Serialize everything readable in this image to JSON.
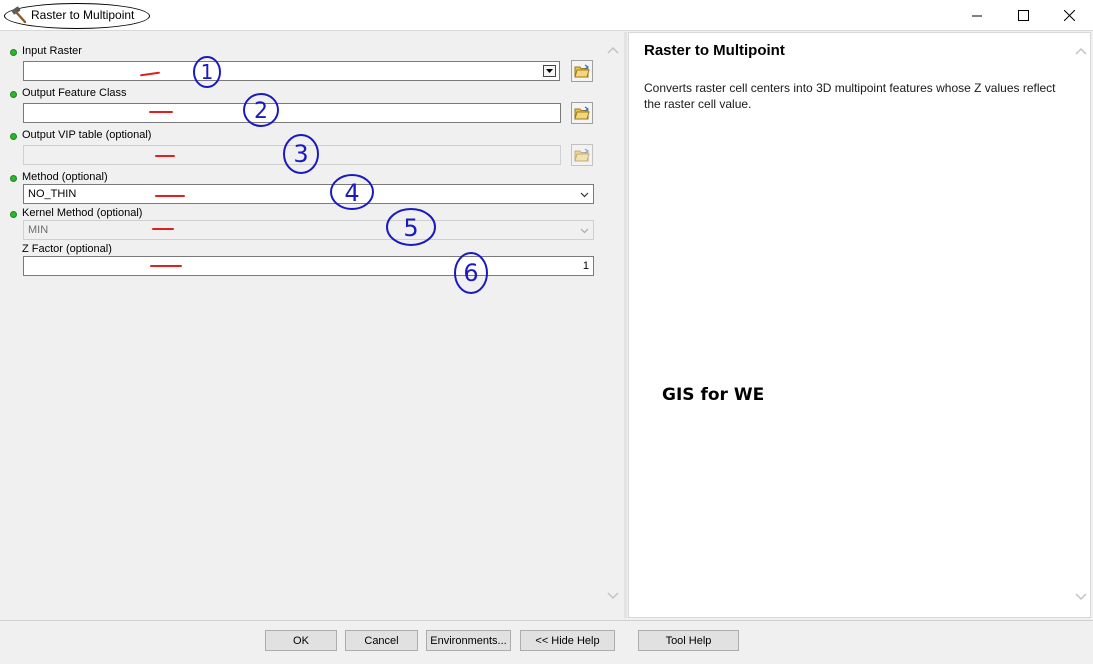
{
  "window": {
    "title": "Raster to Multipoint",
    "controls": [
      "minimize",
      "maximize",
      "close"
    ]
  },
  "params": [
    {
      "label": "Input Raster",
      "value": "",
      "type": "combo-browse",
      "required": true
    },
    {
      "label": "Output Feature Class",
      "value": "",
      "type": "text-browse",
      "required": true
    },
    {
      "label": "Output VIP table (optional)",
      "value": "",
      "type": "text-browse",
      "disabled": true,
      "required": true
    },
    {
      "label": "Method (optional)",
      "value": "NO_THIN",
      "type": "select",
      "required": true
    },
    {
      "label": "Kernel Method (optional)",
      "value": "MIN",
      "type": "select",
      "disabled": true,
      "required": true
    },
    {
      "label": "Z Factor (optional)",
      "value": "1",
      "type": "number",
      "required": false
    }
  ],
  "annotations": [
    "1",
    "2",
    "3",
    "4",
    "5",
    "6"
  ],
  "help": {
    "title": "Raster to Multipoint",
    "description": "Converts raster cell centers into 3D multipoint features whose Z values reflect the raster cell value.",
    "watermark": "GIS for WE"
  },
  "buttons": {
    "ok": "OK",
    "cancel": "Cancel",
    "environments": "Environments...",
    "hide_help": "<< Hide Help",
    "tool_help": "Tool Help"
  },
  "colors": {
    "required_dot": "#2db52d",
    "annotation_ink": "#1a1ac0",
    "annotation_dash": "#e02020"
  },
  "icons": [
    "hammer-icon",
    "folder-open-icon",
    "chevron-down-icon",
    "scroll-up-icon",
    "scroll-down-icon"
  ]
}
